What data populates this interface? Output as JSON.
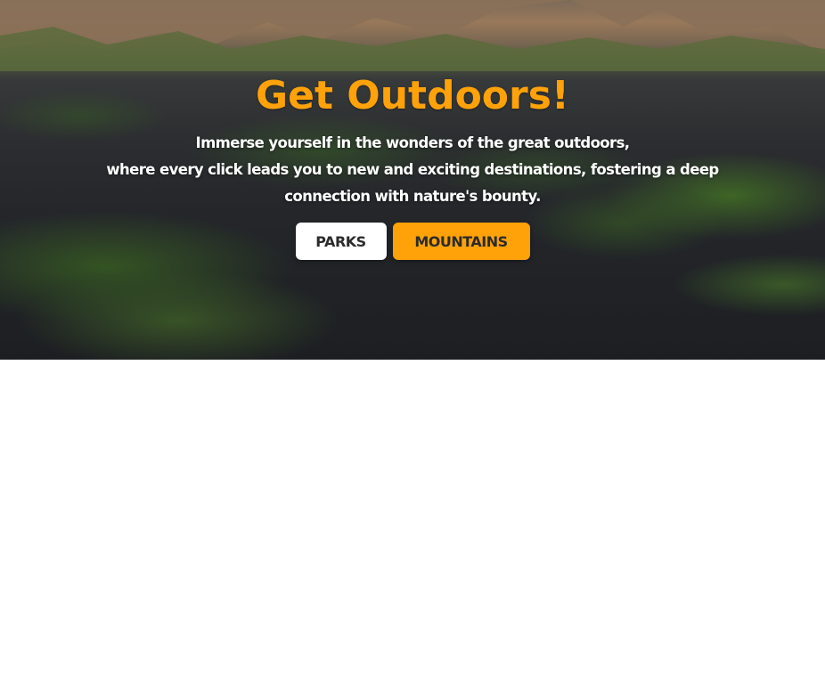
{
  "hero": {
    "title": "Get Outdoors!",
    "subtitle_lines": [
      "Immerse yourself in the wonders of the great outdoors,",
      "where every click leads you to new and exciting destinations, fostering a deep",
      "connection with nature's bounty."
    ],
    "buttons": {
      "parks_label": "PARKS",
      "mountains_label": "MOUNTAINS"
    }
  },
  "colors": {
    "accent": "#ffa20a",
    "button_text": "#2b2b2b",
    "hero_text": "#ffffff",
    "page_background": "#ffffff"
  }
}
